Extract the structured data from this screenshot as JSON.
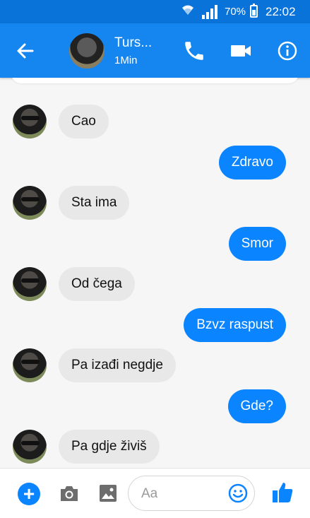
{
  "status_bar": {
    "battery": "70%",
    "time": "22:02"
  },
  "header": {
    "contact_name": "Turs...",
    "contact_status": "1Min"
  },
  "messages": [
    {
      "side": "in",
      "text": "Cao"
    },
    {
      "side": "out",
      "text": "Zdravo"
    },
    {
      "side": "in",
      "text": "Sta ima"
    },
    {
      "side": "out",
      "text": "Smor"
    },
    {
      "side": "in",
      "text": "Od čega"
    },
    {
      "side": "out",
      "text": "Bzvz raspust"
    },
    {
      "side": "in",
      "text": "Pa izađi negdje"
    },
    {
      "side": "out",
      "text": "Gde?"
    },
    {
      "side": "in",
      "text": "Pa gdje živiš"
    }
  ],
  "composer": {
    "placeholder": "Aa"
  },
  "colors": {
    "header": "#1585f0",
    "status_bar": "#0a73d9",
    "outgoing_bubble": "#0a84ff",
    "incoming_bubble": "#e8e8e8"
  },
  "icons": [
    "back-arrow-icon",
    "phone-icon",
    "video-camera-icon",
    "info-icon",
    "plus-icon",
    "camera-icon",
    "image-icon",
    "emoji-icon",
    "thumbs-up-icon"
  ]
}
